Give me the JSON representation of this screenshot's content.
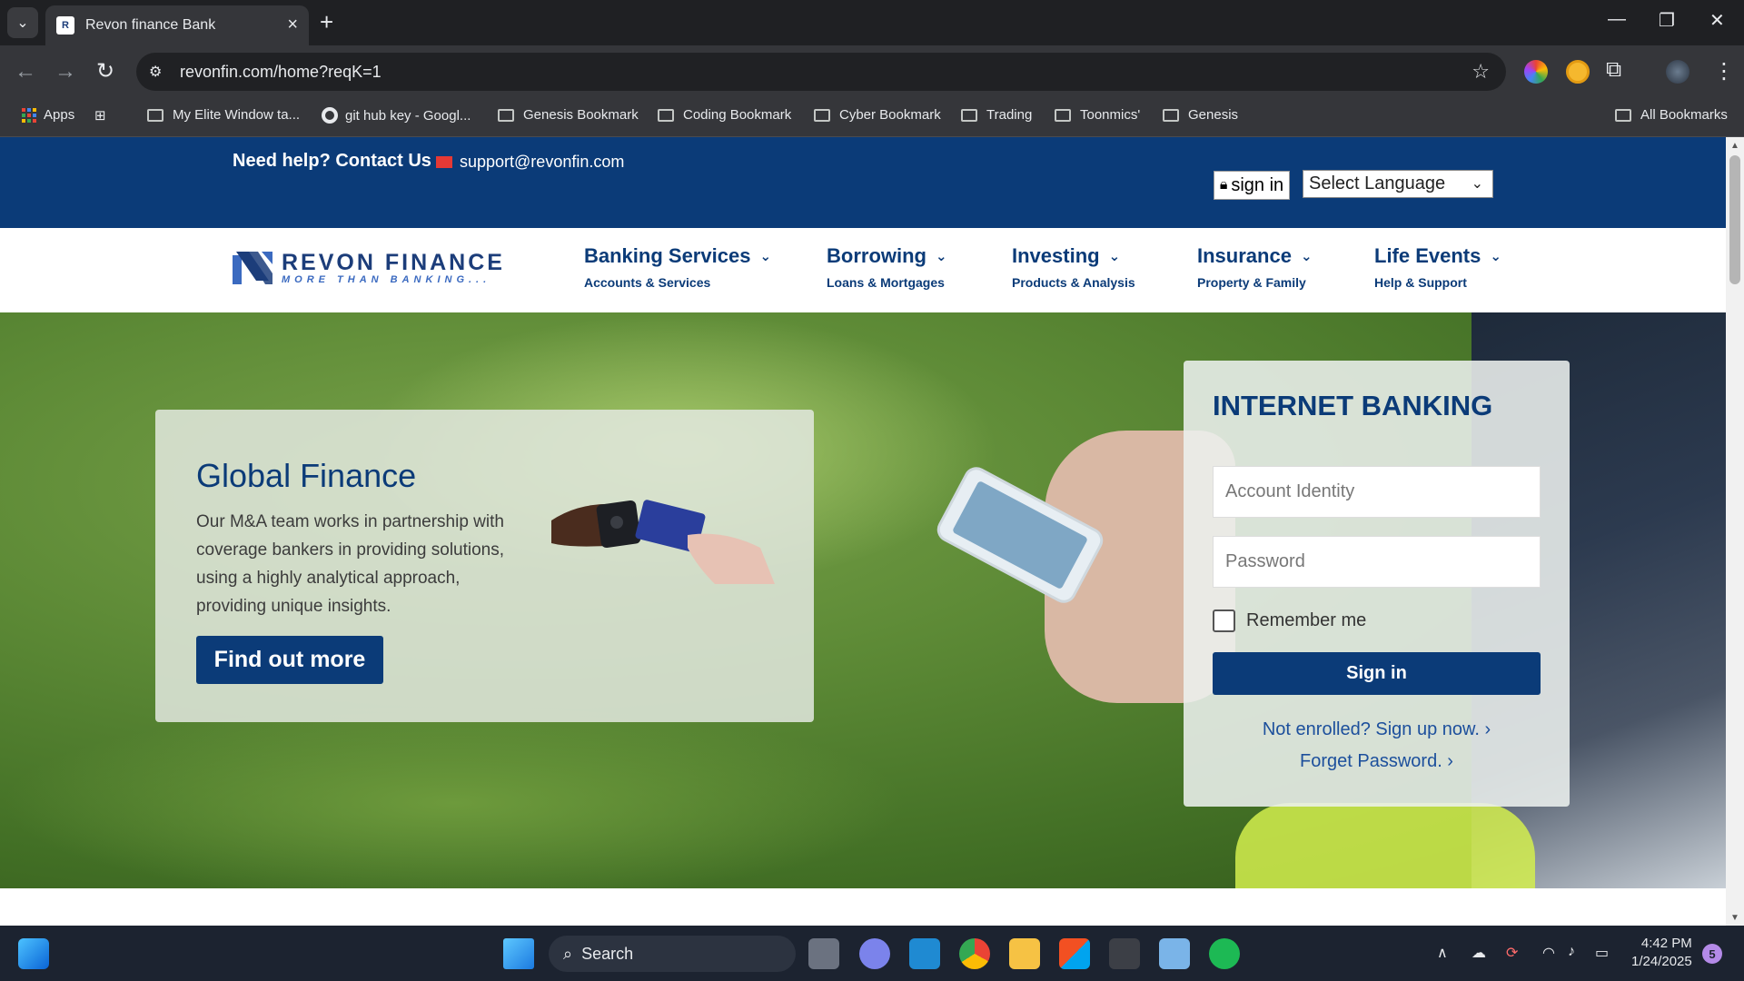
{
  "browser": {
    "tab_title": "Revon finance Bank",
    "url": "revonfin.com/home?reqK=1",
    "bookmarks": [
      {
        "label": "Apps",
        "type": "apps"
      },
      {
        "label": "My Elite Window ta...",
        "type": "folder"
      },
      {
        "label": "git hub key - Googl...",
        "type": "google"
      },
      {
        "label": "Genesis Bookmark",
        "type": "folder"
      },
      {
        "label": "Coding Bookmark",
        "type": "folder"
      },
      {
        "label": "Cyber Bookmark",
        "type": "folder"
      },
      {
        "label": "Trading",
        "type": "folder"
      },
      {
        "label": "Toonmics'",
        "type": "folder"
      },
      {
        "label": "Genesis",
        "type": "folder"
      }
    ],
    "all_bookmarks": "All Bookmarks"
  },
  "topbar": {
    "help_text": "Need help? Contact Us",
    "email": "support@revonfin.com",
    "signin_label": "sign in",
    "language_label": "Select Language"
  },
  "logo": {
    "name": "REVON FINANCE",
    "tagline": "MORE THAN BANKING..."
  },
  "nav": [
    {
      "title": "Banking Services",
      "subtitle": "Accounts & Services"
    },
    {
      "title": "Borrowing",
      "subtitle": "Loans & Mortgages"
    },
    {
      "title": "Investing",
      "subtitle": "Products & Analysis"
    },
    {
      "title": "Insurance",
      "subtitle": "Property & Family"
    },
    {
      "title": "Life Events",
      "subtitle": "Help & Support"
    }
  ],
  "promo": {
    "title": "Global Finance",
    "body": "Our M&A team works in partnership with coverage bankers in providing solutions, using a highly analytical approach, providing unique insights.",
    "button": "Find out more"
  },
  "login": {
    "title": "INTERNET BANKING",
    "account_placeholder": "Account Identity",
    "password_placeholder": "Password",
    "remember_label": "Remember me",
    "signin_button": "Sign in",
    "enroll_link": "Not enrolled? Sign up now. ›",
    "forgot_link": "Forget Password. ›"
  },
  "taskbar": {
    "search_label": "Search",
    "time": "4:42 PM",
    "date": "1/24/2025",
    "notification_count": "5"
  },
  "colors": {
    "brand_navy": "#0b3b78",
    "link_blue": "#1c4f9c",
    "mail_red": "#e53935"
  }
}
